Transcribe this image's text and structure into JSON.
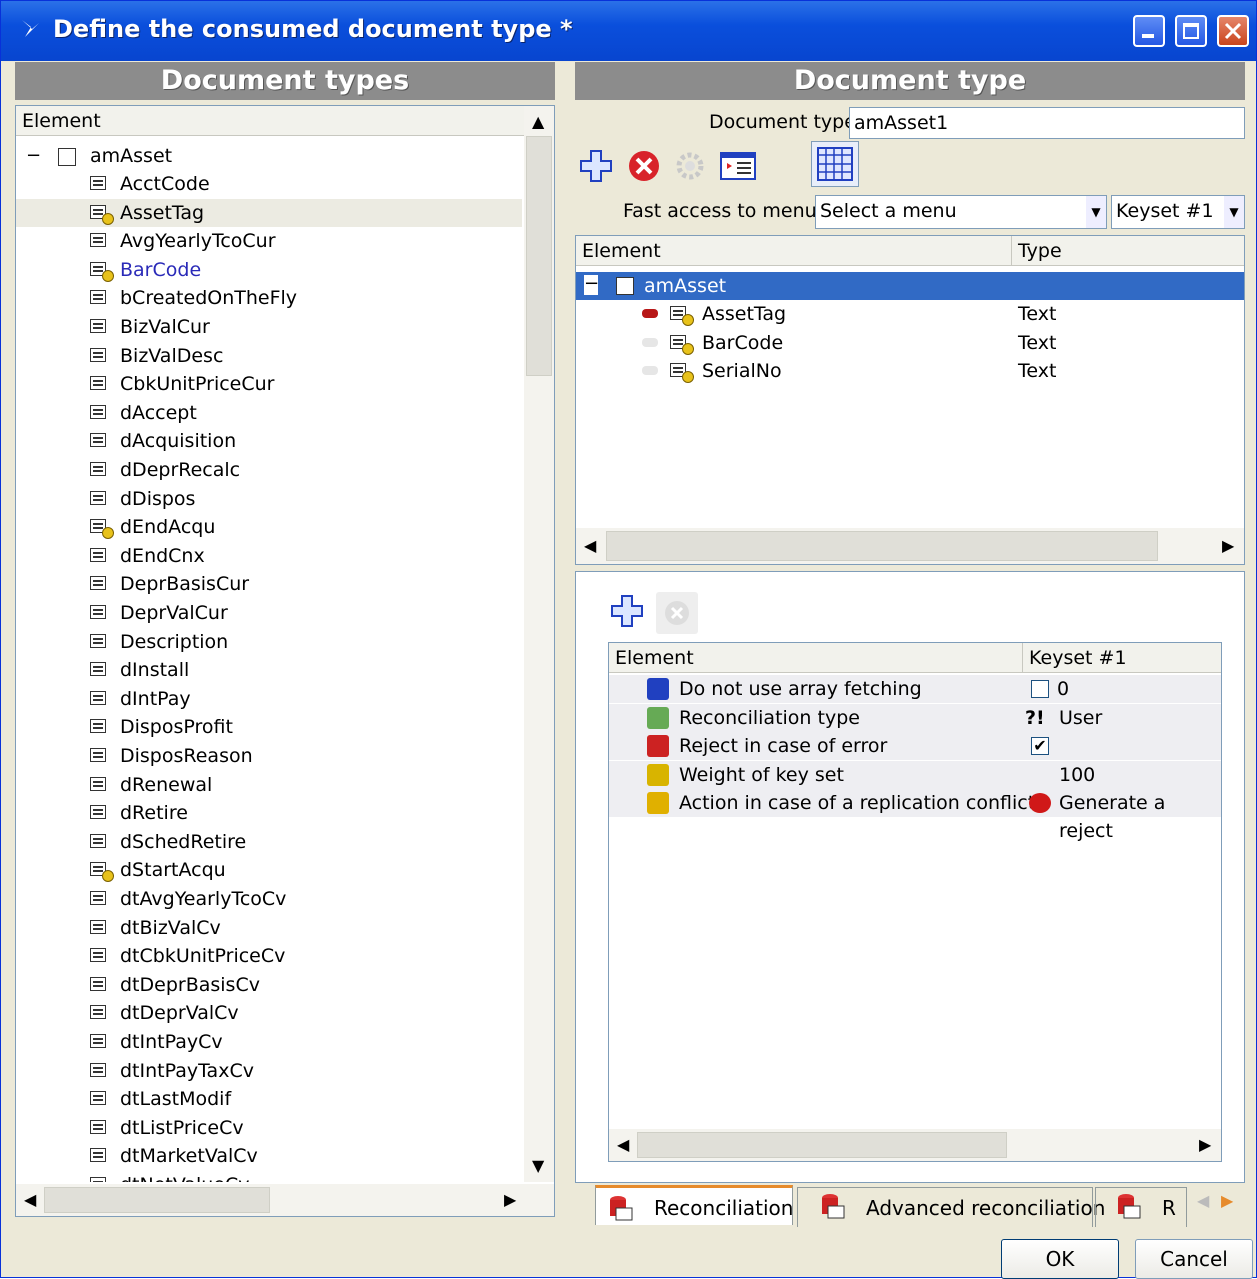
{
  "window": {
    "title": "Define the consumed document type *",
    "minimize_label": "_",
    "maximize_label": "□",
    "close_label": "✕"
  },
  "left_panel": {
    "header": "Document types",
    "column_header": "Element",
    "root": "amAsset",
    "items": [
      {
        "label": "AcctCode",
        "key": false
      },
      {
        "label": "AssetTag",
        "key": true,
        "selected": true
      },
      {
        "label": "AvgYearlyTcoCur",
        "key": false
      },
      {
        "label": "BarCode",
        "key": true,
        "blue": true
      },
      {
        "label": "bCreatedOnTheFly",
        "key": false
      },
      {
        "label": "BizValCur",
        "key": false
      },
      {
        "label": "BizValDesc",
        "key": false
      },
      {
        "label": "CbkUnitPriceCur",
        "key": false
      },
      {
        "label": "dAccept",
        "key": false
      },
      {
        "label": "dAcquisition",
        "key": false
      },
      {
        "label": "dDeprRecalc",
        "key": false
      },
      {
        "label": "dDispos",
        "key": false
      },
      {
        "label": "dEndAcqu",
        "key": true
      },
      {
        "label": "dEndCnx",
        "key": false
      },
      {
        "label": "DeprBasisCur",
        "key": false
      },
      {
        "label": "DeprValCur",
        "key": false
      },
      {
        "label": "Description",
        "key": false
      },
      {
        "label": "dInstall",
        "key": false
      },
      {
        "label": "dIntPay",
        "key": false
      },
      {
        "label": "DisposProfit",
        "key": false
      },
      {
        "label": "DisposReason",
        "key": false
      },
      {
        "label": "dRenewal",
        "key": false
      },
      {
        "label": "dRetire",
        "key": false
      },
      {
        "label": "dSchedRetire",
        "key": false
      },
      {
        "label": "dStartAcqu",
        "key": true
      },
      {
        "label": "dtAvgYearlyTcoCv",
        "key": false
      },
      {
        "label": "dtBizValCv",
        "key": false
      },
      {
        "label": "dtCbkUnitPriceCv",
        "key": false
      },
      {
        "label": "dtDeprBasisCv",
        "key": false
      },
      {
        "label": "dtDeprValCv",
        "key": false
      },
      {
        "label": "dtIntPayCv",
        "key": false
      },
      {
        "label": "dtIntPayTaxCv",
        "key": false
      },
      {
        "label": "dtLastModif",
        "key": false
      },
      {
        "label": "dtListPriceCv",
        "key": false
      },
      {
        "label": "dtMarketValCv",
        "key": false
      },
      {
        "label": "dtNetValueCv",
        "key": false
      }
    ]
  },
  "right_panel": {
    "header": "Document type",
    "doc_type_label": "Document type:",
    "doc_type_value": "amAsset1",
    "fast_access_label": "Fast access to menus:",
    "menu_value": "Select a menu",
    "keyset_value": "Keyset #1",
    "tree": {
      "col_element": "Element",
      "col_type": "Type",
      "root": "amAsset",
      "rows": [
        {
          "label": "AssetTag",
          "type": "Text"
        },
        {
          "label": "BarCode",
          "type": "Text"
        },
        {
          "label": "SerialNo",
          "type": "Text"
        }
      ]
    },
    "props": {
      "col_element": "Element",
      "col_keyset": "Keyset #1",
      "rows": [
        {
          "label": "Do not use array fetching",
          "value": "0",
          "icon": "array-fetch-icon"
        },
        {
          "label": "Reconciliation type",
          "value": "User",
          "icon": "reconciliation-icon"
        },
        {
          "label": "Reject in case of error",
          "value": "",
          "icon": "traffic-light-icon"
        },
        {
          "label": "Weight of key set",
          "value": "100",
          "icon": "weight-icon"
        },
        {
          "label": "Action in case of a replication conflict",
          "value": "Generate a reject",
          "icon": "lightning-icon"
        }
      ]
    },
    "tabs": [
      "Reconciliation",
      "Advanced reconciliation",
      "R"
    ],
    "reconciliation_marker": "?!"
  },
  "buttons": {
    "ok": "OK",
    "cancel": "Cancel"
  },
  "colors": {
    "title_blue": "#0a4fdc",
    "header_gray": "#8c8c8c",
    "selection_blue": "#316ac5",
    "link_blue": "#2a2ab8"
  }
}
